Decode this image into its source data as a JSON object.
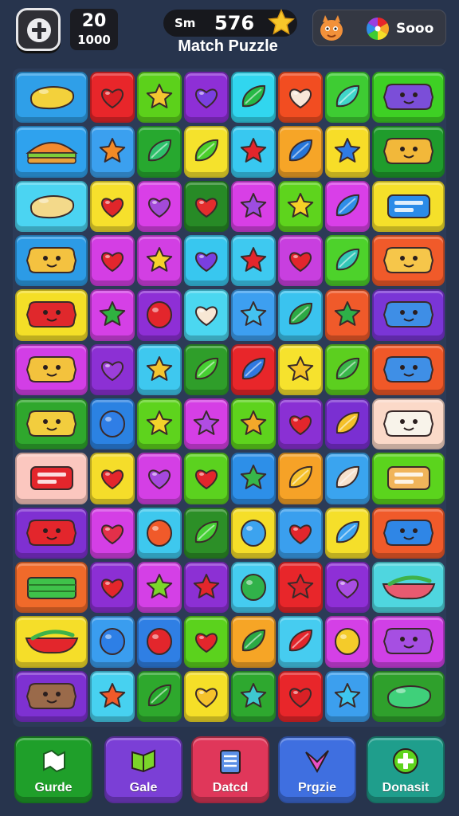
{
  "hud": {
    "moves_value": "20",
    "moves_sub": "1000",
    "score_label": "Sm",
    "score_value": "576",
    "title": "Match Puzzle",
    "right_value": "Sooo",
    "icons": [
      "pause-icon",
      "star-icon",
      "mascot-icon",
      "color-wheel-icon"
    ]
  },
  "board": {
    "rows": [
      [
        {
          "c": "#2f9fe8",
          "s": "blob-w",
          "i": "#f3d13b"
        },
        {
          "c": "#e8262a",
          "s": "heart",
          "i": "#d81f24"
        },
        {
          "c": "#5cd11b",
          "s": "star",
          "i": "#f4c630"
        },
        {
          "c": "#8e2fd6",
          "s": "heart",
          "i": "#7a3fe0"
        },
        {
          "c": "#31d6ef",
          "s": "leaf",
          "i": "#26b845"
        },
        {
          "c": "#f24d21",
          "s": "heart",
          "i": "#f8e7d8"
        },
        {
          "c": "#3ecc33",
          "s": "leaf",
          "i": "#40d6c9"
        },
        {
          "c": "#3ed024",
          "s": "face-w",
          "i": "#7b4ed8"
        }
      ],
      [
        {
          "c": "#2fa2ee",
          "s": "sandwich",
          "i": "#f28a2f"
        },
        {
          "c": "#3ba0ef",
          "s": "star",
          "i": "#f38a26"
        },
        {
          "c": "#27a82f",
          "s": "leaf",
          "i": "#2ec06b"
        },
        {
          "c": "#f5e22c",
          "s": "leaf",
          "i": "#4bcf2c"
        },
        {
          "c": "#38c8f0",
          "s": "star",
          "i": "#e3262c"
        },
        {
          "c": "#f6a527",
          "s": "leaf",
          "i": "#2675d8"
        },
        {
          "c": "#f7dd28",
          "s": "star",
          "i": "#2f7be3"
        },
        {
          "c": "#1f9c2c",
          "s": "face-w",
          "i": "#f2b83a"
        }
      ],
      [
        {
          "c": "#4bd4f2",
          "s": "blob-w",
          "i": "#f3d98a"
        },
        {
          "c": "#f6e02c",
          "s": "heart",
          "i": "#e0262a"
        },
        {
          "c": "#d93fe7",
          "s": "heart",
          "i": "#a34ad9"
        },
        {
          "c": "#278a26",
          "s": "heart",
          "i": "#e42d2d"
        },
        {
          "c": "#d83fe6",
          "s": "star",
          "i": "#9d4de0"
        },
        {
          "c": "#5ed41d",
          "s": "star",
          "i": "#f6d027"
        },
        {
          "c": "#d93fe8",
          "s": "leaf",
          "i": "#2f8de8"
        },
        {
          "c": "#f5e02a",
          "s": "card-w",
          "i": "#2b8be8"
        }
      ],
      [
        {
          "c": "#2c9be6",
          "s": "face-w",
          "i": "#f4c240"
        },
        {
          "c": "#d43ee4",
          "s": "heart",
          "i": "#e3262e"
        },
        {
          "c": "#d23fe3",
          "s": "star",
          "i": "#f5d22a"
        },
        {
          "c": "#38c7ef",
          "s": "heart",
          "i": "#7a3fe0"
        },
        {
          "c": "#3ec9f0",
          "s": "star",
          "i": "#e3262c"
        },
        {
          "c": "#c83fdf",
          "s": "heart",
          "i": "#e2262c"
        },
        {
          "c": "#4dd22b",
          "s": "leaf",
          "i": "#34c7b7"
        },
        {
          "c": "#f05a2a",
          "s": "face-w",
          "i": "#f6c64a"
        }
      ],
      [
        {
          "c": "#f4df27",
          "s": "face-w",
          "i": "#e0282c"
        },
        {
          "c": "#d540e6",
          "s": "star",
          "i": "#2fb240"
        },
        {
          "c": "#8e2fd6",
          "s": "circle",
          "i": "#e3262c"
        },
        {
          "c": "#4bd7f0",
          "s": "heart",
          "i": "#f7e7d4"
        },
        {
          "c": "#3d9ff0",
          "s": "star",
          "i": "#44c2f0"
        },
        {
          "c": "#3ac3ef",
          "s": "leaf",
          "i": "#2caa45"
        },
        {
          "c": "#f05a2a",
          "s": "star",
          "i": "#2eb048"
        },
        {
          "c": "#7a35d6",
          "s": "face-w",
          "i": "#3e8ee6"
        }
      ],
      [
        {
          "c": "#d23ee6",
          "s": "face-w",
          "i": "#f3c23d"
        },
        {
          "c": "#8c30d4",
          "s": "heart",
          "i": "#9b3fd8"
        },
        {
          "c": "#3ec8ef",
          "s": "star",
          "i": "#f3c530"
        },
        {
          "c": "#2f9e2a",
          "s": "leaf",
          "i": "#47cf33"
        },
        {
          "c": "#e8262a",
          "s": "leaf",
          "i": "#2f78e0"
        },
        {
          "c": "#f6e22d",
          "s": "star",
          "i": "#f4c328"
        },
        {
          "c": "#5ccf1f",
          "s": "leaf",
          "i": "#3bb74b"
        },
        {
          "c": "#f05828",
          "s": "face-w",
          "i": "#3f8fe6"
        }
      ],
      [
        {
          "c": "#2fa72d",
          "s": "face-w",
          "i": "#f2cd3e"
        },
        {
          "c": "#2b82e2",
          "s": "circle",
          "i": "#2f7ee6"
        },
        {
          "c": "#5ed31d",
          "s": "star",
          "i": "#f4d22a"
        },
        {
          "c": "#d53fe5",
          "s": "star",
          "i": "#b04de2"
        },
        {
          "c": "#5ed31d",
          "s": "star",
          "i": "#f3a82a"
        },
        {
          "c": "#8a30d4",
          "s": "heart",
          "i": "#e3262c"
        },
        {
          "c": "#7a2fd2",
          "s": "leaf",
          "i": "#f4c029"
        },
        {
          "c": "#fbd9c8",
          "s": "face-w",
          "i": "#f8f3ea"
        }
      ],
      [
        {
          "c": "#fbc7bf",
          "s": "card-w",
          "i": "#e3262c"
        },
        {
          "c": "#f5dd2a",
          "s": "heart",
          "i": "#e3262c"
        },
        {
          "c": "#d43fe5",
          "s": "heart",
          "i": "#a548de"
        },
        {
          "c": "#5bd21f",
          "s": "heart",
          "i": "#e3262c"
        },
        {
          "c": "#2d8fe8",
          "s": "star",
          "i": "#37b64a"
        },
        {
          "c": "#f6a227",
          "s": "leaf",
          "i": "#f5c02c"
        },
        {
          "c": "#3aa4ef",
          "s": "leaf",
          "i": "#f7e1cc"
        },
        {
          "c": "#5bd41d",
          "s": "card-w",
          "i": "#f0b45a"
        }
      ],
      [
        {
          "c": "#7f30d2",
          "s": "face-w",
          "i": "#e3262c"
        },
        {
          "c": "#d43fe5",
          "s": "heart",
          "i": "#e2304a"
        },
        {
          "c": "#3ec8ee",
          "s": "circle",
          "i": "#f05a2a"
        },
        {
          "c": "#2c8f27",
          "s": "leaf",
          "i": "#46cf34"
        },
        {
          "c": "#f5de29",
          "s": "circle",
          "i": "#3ca3ef"
        },
        {
          "c": "#3a9fee",
          "s": "heart",
          "i": "#e3262c"
        },
        {
          "c": "#f5df2a",
          "s": "leaf",
          "i": "#3ca2ef"
        },
        {
          "c": "#f05a2a",
          "s": "face-w",
          "i": "#2f86e6"
        }
      ],
      [
        {
          "c": "#f06a2a",
          "s": "cake",
          "i": "#3fc24a"
        },
        {
          "c": "#8c2fd4",
          "s": "heart",
          "i": "#e3262c"
        },
        {
          "c": "#d440e6",
          "s": "star",
          "i": "#7bd52a"
        },
        {
          "c": "#8c30d4",
          "s": "star",
          "i": "#e3262c"
        },
        {
          "c": "#45ccf0",
          "s": "circle",
          "i": "#31b24a"
        },
        {
          "c": "#e8262a",
          "s": "star",
          "i": "#d62329"
        },
        {
          "c": "#8e2fd6",
          "s": "heart",
          "i": "#a84ee2"
        },
        {
          "c": "#4fd6df",
          "s": "boat",
          "i": "#e85a70"
        }
      ],
      [
        {
          "c": "#f5de29",
          "s": "boat",
          "i": "#e3262c"
        },
        {
          "c": "#3a9def",
          "s": "circle",
          "i": "#2d7fe6"
        },
        {
          "c": "#2f7fe4",
          "s": "circle",
          "i": "#e3262c"
        },
        {
          "c": "#5bd21d",
          "s": "heart",
          "i": "#e3262c"
        },
        {
          "c": "#f6a526",
          "s": "leaf",
          "i": "#2caa45"
        },
        {
          "c": "#46ccf0",
          "s": "leaf",
          "i": "#e3262c"
        },
        {
          "c": "#d440e6",
          "s": "circle",
          "i": "#f4cb2a"
        },
        {
          "c": "#d040e6",
          "s": "face-w",
          "i": "#a64fe2"
        }
      ],
      [
        {
          "c": "#7e31d2",
          "s": "face-w",
          "i": "#9a6a4a"
        },
        {
          "c": "#47d1f0",
          "s": "star",
          "i": "#f05a2a"
        },
        {
          "c": "#2ea82d",
          "s": "leaf",
          "i": "#28a82f"
        },
        {
          "c": "#f5df28",
          "s": "heart",
          "i": "#f5c22c"
        },
        {
          "c": "#2ea82f",
          "s": "star",
          "i": "#3ec8cf"
        },
        {
          "c": "#e8262a",
          "s": "heart",
          "i": "#d92126"
        },
        {
          "c": "#3c9fee",
          "s": "star",
          "i": "#3ec6ef"
        },
        {
          "c": "#2fa02c",
          "s": "blob-w",
          "i": "#3fd07a"
        }
      ]
    ]
  },
  "bottom_nav": [
    {
      "label": "Gurde",
      "color": "#1f9f2a",
      "icon": "map-icon"
    },
    {
      "label": "Gale",
      "color": "#7b3fd6",
      "icon": "leaf-book-icon"
    },
    {
      "label": "Datcd",
      "color": "#e0375a",
      "icon": "list-card-icon"
    },
    {
      "label": "Prgzie",
      "color": "#3f6fe0",
      "icon": "heart-check-icon"
    },
    {
      "label": "Donasit",
      "color": "#1f9e8c",
      "icon": "plus-badge-icon"
    }
  ]
}
